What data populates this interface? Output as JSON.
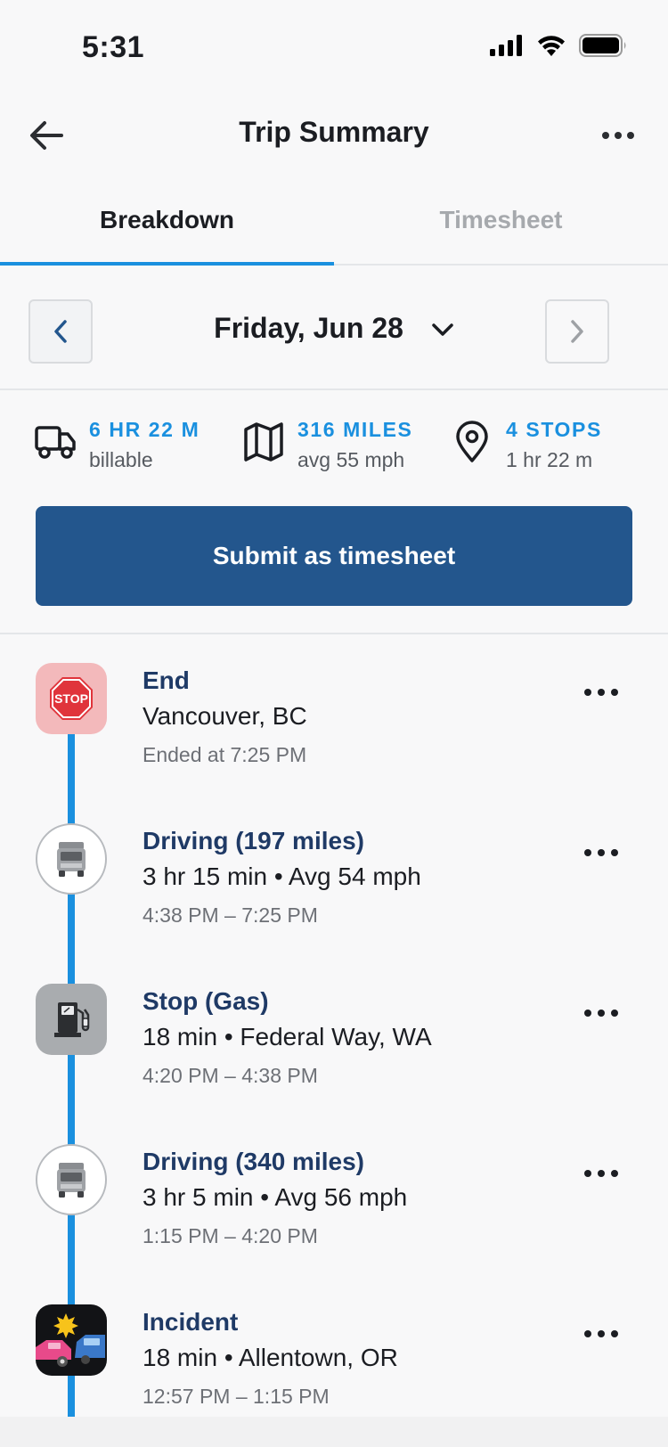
{
  "status_bar": {
    "time": "5:31"
  },
  "header": {
    "title": "Trip Summary"
  },
  "tabs": [
    {
      "label": "Breakdown",
      "active": true
    },
    {
      "label": "Timesheet",
      "active": false
    }
  ],
  "date_nav": {
    "label": "Friday, Jun 28"
  },
  "stats": [
    {
      "icon": "truck-icon",
      "value": "6 HR 22 M",
      "sub": "billable"
    },
    {
      "icon": "map-icon",
      "value": "316 MILES",
      "sub": "avg 55 mph"
    },
    {
      "icon": "location-pin-icon",
      "value": "4 STOPS",
      "sub": "1 hr 22 m"
    }
  ],
  "submit_button": {
    "label": "Submit as timesheet"
  },
  "events": [
    {
      "icon": "stop-sign-icon",
      "title": "End",
      "desc": "Vancouver, BC",
      "meta": "Ended at 7:25 PM"
    },
    {
      "icon": "truck-icon",
      "title": "Driving (197 miles)",
      "desc": "3 hr 15 min • Avg 54 mph",
      "meta": "4:38 PM – 7:25 PM"
    },
    {
      "icon": "fuel-pump-icon",
      "title": "Stop (Gas)",
      "desc": "18 min • Federal Way, WA",
      "meta": "4:20 PM – 4:38 PM"
    },
    {
      "icon": "truck-icon",
      "title": "Driving (340 miles)",
      "desc": "3 hr 5 min • Avg 56 mph",
      "meta": "1:15 PM – 4:20 PM"
    },
    {
      "icon": "car-crash-icon",
      "title": "Incident",
      "desc": "18 min • Allentown, OR",
      "meta": "12:57 PM – 1:15 PM"
    }
  ],
  "colors": {
    "accent": "#1a90df",
    "primary_button": "#23568d",
    "event_title": "#1f3a66",
    "background": "#f8f8f9"
  }
}
